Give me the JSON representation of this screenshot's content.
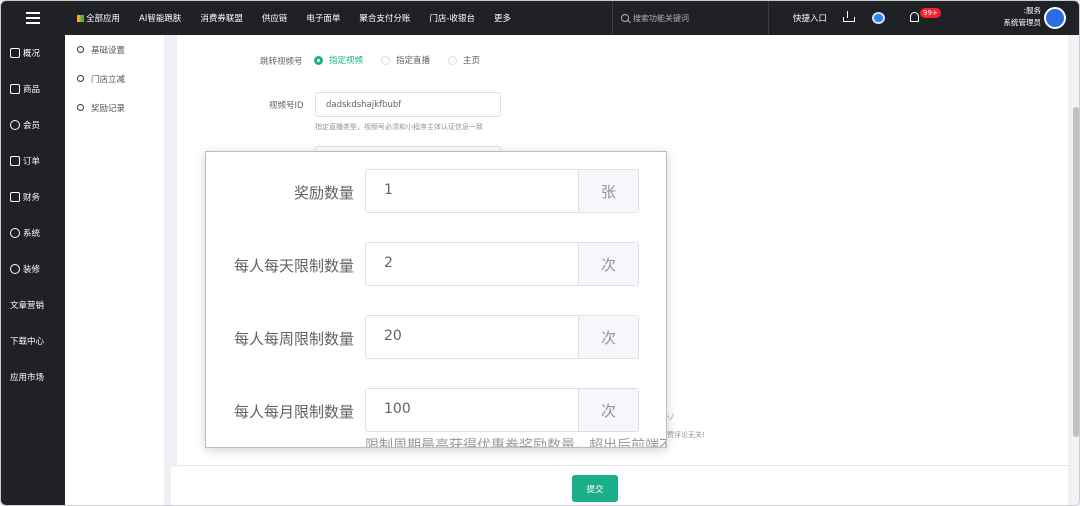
{
  "topbar": {
    "nav": [
      "全部应用",
      "AI智能跑肤",
      "消费券联盟",
      "供应链",
      "电子面单",
      "聚合支付分账",
      "门店-收银台",
      "更多"
    ],
    "search_placeholder": "搜索功能关键词",
    "quick_entry": "快捷入口",
    "notification_count": "99+",
    "user_line1": ":服务",
    "user_line2": "系统管理员"
  },
  "sidebar": {
    "items": [
      "概况",
      "商品",
      "会员",
      "订单",
      "财务",
      "系统",
      "装修",
      "文章营销",
      "下载中心",
      "应用市场"
    ]
  },
  "submenu": {
    "items": [
      "基础设置",
      "门店立减",
      "奖励记录"
    ]
  },
  "form": {
    "jump_label": "跳转视频号",
    "jump_options": [
      "指定视频",
      "指定直播",
      "主页"
    ],
    "jump_selected": "指定视频",
    "channel_id_label": "视频号ID",
    "channel_id_value": "dadskdshajkfbubf",
    "channel_id_hint": "指定直播类型，视频号必须和小程序主体认证信息一致",
    "behind_hint_1": "ゾ",
    "behind_hint_2": "赞评论无关!"
  },
  "zoom": {
    "rows": [
      {
        "label": "奖励数量",
        "value": "1",
        "unit": "张"
      },
      {
        "label": "每人每天限制数量",
        "value": "2",
        "unit": "次"
      },
      {
        "label": "每人每周限制数量",
        "value": "20",
        "unit": "次"
      },
      {
        "label": "每人每月限制数量",
        "value": "100",
        "unit": "次"
      }
    ],
    "cut_text": "限制周期最高获得优惠券奖励数量，超出后前端不再"
  },
  "footer": {
    "submit_label": "提交"
  },
  "colors": {
    "accent": "#1aaf8b",
    "sidebar_bg": "#1f2124",
    "badge": "#f5222d"
  }
}
